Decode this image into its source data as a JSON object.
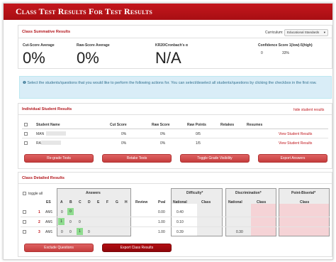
{
  "window": {
    "title": "Class Test Results For Test Results"
  },
  "summary": {
    "section_title": "Class Summative Results",
    "curriculum_label": "Curriculum:",
    "curriculum_value": "Educational Standards",
    "cut_label": "Cut-Score Average",
    "cut_value": "0%",
    "raw_label": "Raw-Score Average",
    "raw_value": "0%",
    "kr_label": "KR20/Cronbach's α",
    "kr_value": "N/A",
    "conf_label": "Confidence Score 1(low)-5(high)",
    "conf_num": "0",
    "conf_pct": "33%"
  },
  "info_text": "Select the students/questions that you would like to perform the following actions for. You can select/deselect all students/questions by clicking the checkbox in the first row.",
  "individual": {
    "section_title": "Individual Student Results",
    "hide_link": "hide student results",
    "headers": {
      "name": "Student Name",
      "cut": "Cut Score",
      "raw": "Raw Score",
      "points": "Raw Points",
      "retakes": "Retakes",
      "resumes": "Resumes"
    },
    "students": [
      {
        "name": "MAN",
        "cut": "0%",
        "raw": "0%",
        "points": "0/5",
        "link": "View Student Results"
      },
      {
        "name": "RA",
        "cut": "0%",
        "raw": "0%",
        "points": "1/5",
        "link": "View Student Results"
      }
    ],
    "buttons": [
      "Re-grade Tests",
      "Retake Tests",
      "Toggle Grade Visibility",
      "Export Answers"
    ]
  },
  "detailed": {
    "section_title": "Class Detailed Results",
    "toggle_all": "toggle all",
    "answers_header": "Answers",
    "difficulty_header": "Difficulty*",
    "discrimination_header": "Discrimination*",
    "pb_header": "Point-Biserial*",
    "cols": {
      "es": "ES",
      "a": "A",
      "b": "B",
      "c": "C",
      "d": "D",
      "e": "E",
      "f": "F",
      "g": "G",
      "h": "H",
      "review": "Review",
      "pval": "Pval",
      "national": "National",
      "class": "Class"
    },
    "rows": [
      {
        "num": "1",
        "es": "AM1",
        "answers": [
          "0",
          "0",
          "",
          "",
          "",
          "",
          "",
          ""
        ],
        "pval": "0.00",
        "diff_national": "0.40",
        "disc_class": ""
      },
      {
        "num": "2",
        "es": "AM1",
        "answers": [
          "1",
          "0",
          "0",
          "",
          "",
          "",
          "",
          ""
        ],
        "pval": "1.00",
        "diff_national": "0.10",
        "disc_class": ""
      },
      {
        "num": "3",
        "es": "AM1",
        "answers": [
          "0",
          "0",
          "1",
          "0",
          "",
          "",
          "",
          ""
        ],
        "pval": "1.00",
        "diff_national": "0.39",
        "disc_class": "0.30"
      }
    ],
    "buttons": [
      "Exclude Questions",
      "Export Class Results"
    ]
  }
}
